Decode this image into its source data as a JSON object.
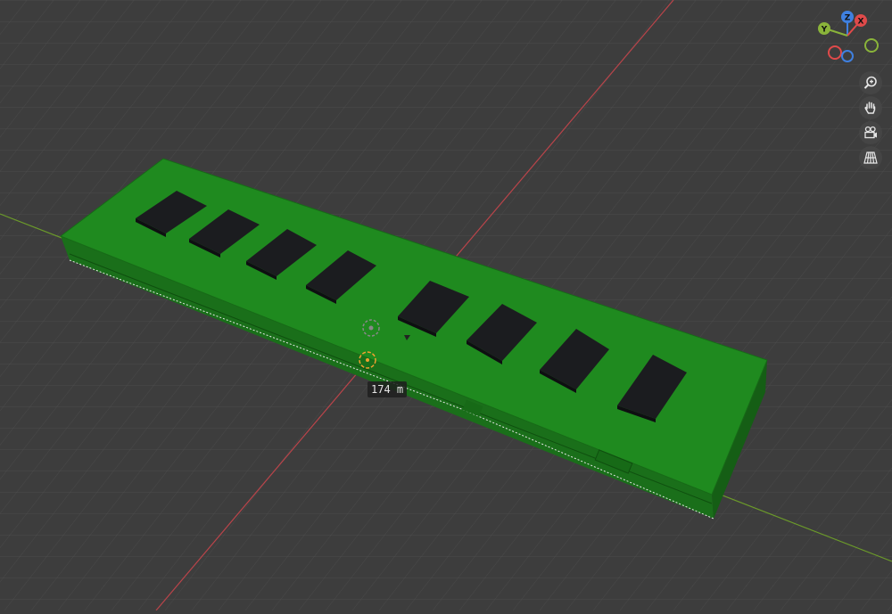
{
  "viewport": {
    "background_color": "#3d3d3d",
    "grid_color": "#4f4f4f",
    "x_axis_color": "#b9444a",
    "y_axis_color": "#6b9a2a"
  },
  "model": {
    "board_color": "#1f8a1f",
    "chip_color": "#1b1c1f",
    "chip_count": 8
  },
  "gizmo": {
    "z_label": "Z",
    "x_label": "X",
    "y_label": "Y",
    "z_color": "#3f80e0",
    "x_color": "#e04a4a",
    "y_color": "#8ab43a"
  },
  "nav_buttons": [
    {
      "icon": "zoom-icon"
    },
    {
      "icon": "hand-pan-icon"
    },
    {
      "icon": "camera-icon"
    },
    {
      "icon": "grid-perspective-icon"
    }
  ],
  "measurement": {
    "value": "174 m"
  }
}
